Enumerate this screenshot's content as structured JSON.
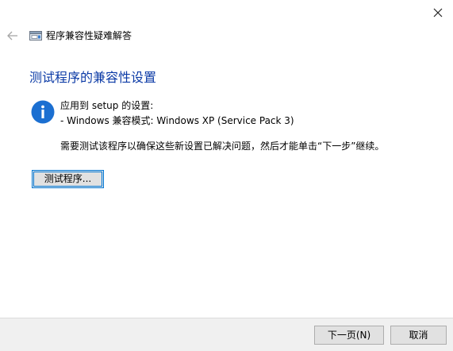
{
  "header": {
    "window_title": "程序兼容性疑难解答",
    "back_icon": "arrow-left-icon",
    "close_icon": "close-icon",
    "app_icon": "compatibility-troubleshooter-icon"
  },
  "main": {
    "page_title": "测试程序的兼容性设置",
    "info_icon": "info-icon",
    "info_line1": "应用到 setup 的设置:",
    "info_line2": "- Windows 兼容模式: Windows XP (Service Pack 3)",
    "instruction": "需要测试该程序以确保这些新设置已解决问题，然后才能单击“下一步”继续。",
    "test_button_label": "测试程序..."
  },
  "footer": {
    "next_button_label": "下一页(N)",
    "cancel_button_label": "取消"
  },
  "colors": {
    "title_blue": "#0b3aa6",
    "info_blue": "#1b6fd1",
    "focus_border": "#0078d7",
    "footer_bg": "#f0f0f0"
  }
}
